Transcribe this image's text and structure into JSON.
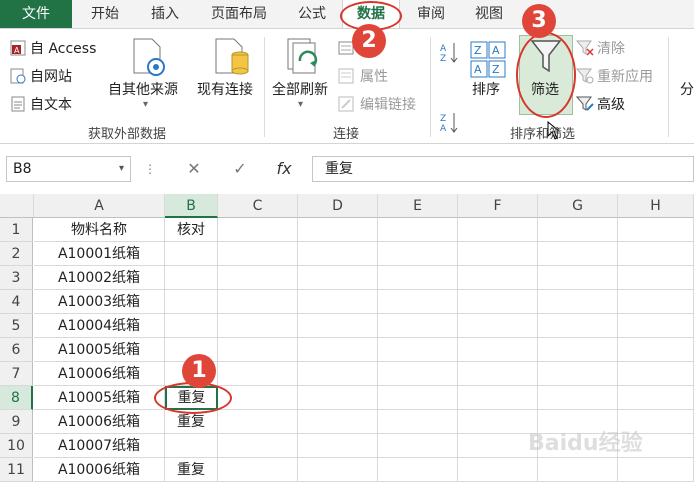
{
  "tabs": [
    "文件",
    "开始",
    "插入",
    "页面布局",
    "公式",
    "数据",
    "审阅",
    "视图"
  ],
  "ribbon": {
    "external": {
      "access": "自 Access",
      "web": "自网站",
      "text": "自文本",
      "other": "自其他来源",
      "existing": "现有连接",
      "group_label": "获取外部数据"
    },
    "connections": {
      "refresh_all": "全部刷新",
      "properties": "属性",
      "edit_links": "编辑链接",
      "group_label": "连接"
    },
    "sort_filter": {
      "sort": "排序",
      "filter": "筛选",
      "clear": "清除",
      "reapply": "重新应用",
      "advanced": "高级",
      "group_label": "排序和筛选"
    },
    "partial_next": "分"
  },
  "formula_bar": {
    "name_box": "B8",
    "fx": "fx",
    "content": "重复"
  },
  "columns": [
    "A",
    "B",
    "C",
    "D",
    "E",
    "F",
    "G",
    "H"
  ],
  "rows": [
    {
      "num": "1",
      "a": "物料名称",
      "b": "核对"
    },
    {
      "num": "2",
      "a": "A10001纸箱",
      "b": ""
    },
    {
      "num": "3",
      "a": "A10002纸箱",
      "b": ""
    },
    {
      "num": "4",
      "a": "A10003纸箱",
      "b": ""
    },
    {
      "num": "5",
      "a": "A10004纸箱",
      "b": ""
    },
    {
      "num": "6",
      "a": "A10005纸箱",
      "b": ""
    },
    {
      "num": "7",
      "a": "A10006纸箱",
      "b": ""
    },
    {
      "num": "8",
      "a": "A10005纸箱",
      "b": "重复"
    },
    {
      "num": "9",
      "a": "A10006纸箱",
      "b": "重复"
    },
    {
      "num": "10",
      "a": "A10007纸箱",
      "b": ""
    },
    {
      "num": "11",
      "a": "A10006纸箱",
      "b": "重复"
    }
  ],
  "selected_cell": "B8",
  "annotations": [
    "1",
    "2",
    "3"
  ],
  "watermark": "Baidu经验",
  "colors": {
    "accent": "#217346",
    "annotation": "#e0453a"
  }
}
